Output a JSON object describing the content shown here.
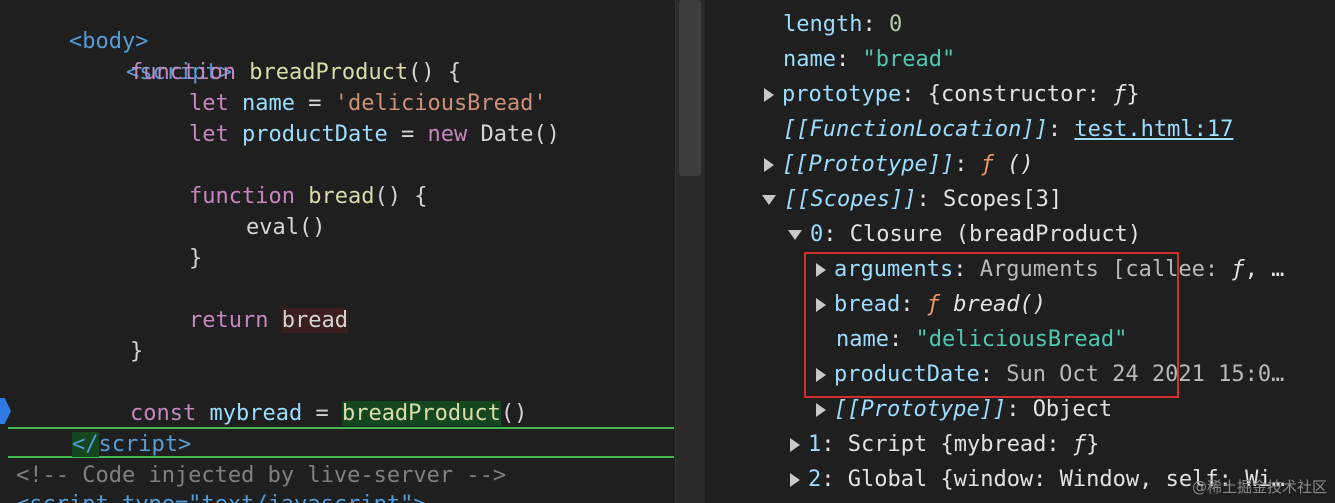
{
  "editor": {
    "body_open": "<body>",
    "script_open": "<script>",
    "fn_kw": "function",
    "fn_outer_name": "breadProduct",
    "fn_parens_brace": "() {",
    "let_kw": "let",
    "var_name": "name",
    "eq": "=",
    "str_value": "'deliciousBread'",
    "var_productDate": "productDate",
    "new_kw": "new",
    "date_ctor": "Date",
    "call_parens": "()",
    "fn_inner_name": "bread",
    "eval_call": "eval",
    "close_brace": "}",
    "return_kw": "return",
    "return_val": "bread",
    "const_kw": "const",
    "var_mybread": "mybread",
    "call_target": "breadProduct",
    "script_close_lt": "</",
    "script_close_rest": "script>",
    "comment": "<!-- Code injected by live-server -->",
    "partial_line": "<script type=\"text/javascript\">"
  },
  "inspector": {
    "length_key": "length",
    "length_val": "0",
    "name_key": "name",
    "name_val": "\"bread\"",
    "prototype_key": "prototype",
    "prototype_val_open": "{constructor: ",
    "f_glyph": "ƒ",
    "brace_close": "}",
    "fnloc_key": "[[FunctionLocation]]",
    "fnloc_val": "test.html:17",
    "proto_int_key": "[[Prototype]]",
    "proto_int_val": " ()",
    "scopes_key": "[[Scopes]]",
    "scopes_val": "Scopes[3]",
    "scope0_key": "0",
    "scope0_val": "Closure (breadProduct)",
    "arguments_key": "arguments",
    "arguments_val": "Arguments [callee: ",
    "arguments_tail": ", …",
    "bread_key": "bread",
    "bread_val": "bread()",
    "closure_name_key": "name",
    "closure_name_val": "\"deliciousBread\"",
    "productDate_key": "productDate",
    "productDate_val": "Sun Oct 24 2021 15:0…",
    "closure_proto_key": "[[Prototype]]",
    "closure_proto_val": "Object",
    "scope1_key": "1",
    "scope1_val_open": "Script {mybread: ",
    "scope2_key": "2",
    "scope2_val": "Global {window: Window, self: Wi…"
  },
  "watermark": "@稀土掘金技术社区",
  "colors": {
    "background": "#1f1f1f",
    "highlight_green": "#14461f",
    "closure_box": "#d0312d",
    "breakpoint": "#2f7ae5"
  }
}
